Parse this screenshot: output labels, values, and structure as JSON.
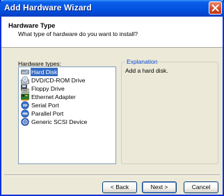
{
  "window": {
    "title": "Add Hardware Wizard"
  },
  "header": {
    "title": "Hardware Type",
    "subtitle": "What type of hardware do you want to install?"
  },
  "hardware_types": {
    "label": "Hardware types:",
    "items": [
      {
        "label": "Hard Disk",
        "icon": "hard-disk-icon",
        "selected": true
      },
      {
        "label": "DVD/CD-ROM Drive",
        "icon": "cdrom-icon",
        "selected": false
      },
      {
        "label": "Floppy Drive",
        "icon": "floppy-icon",
        "selected": false
      },
      {
        "label": "Ethernet Adapter",
        "icon": "network-adapter-icon",
        "selected": false
      },
      {
        "label": "Serial Port",
        "icon": "serial-port-icon",
        "selected": false
      },
      {
        "label": "Parallel Port",
        "icon": "parallel-port-icon",
        "selected": false
      },
      {
        "label": "Generic SCSI Device",
        "icon": "scsi-icon",
        "selected": false
      }
    ]
  },
  "explanation": {
    "label": "Explanation",
    "text": "Add a hard disk."
  },
  "buttons": {
    "back": "< Back",
    "next": "Next >",
    "cancel": "Cancel"
  },
  "colors": {
    "titlebar": "#0554e3",
    "selection": "#316ac5",
    "group_label": "#0046d5"
  }
}
